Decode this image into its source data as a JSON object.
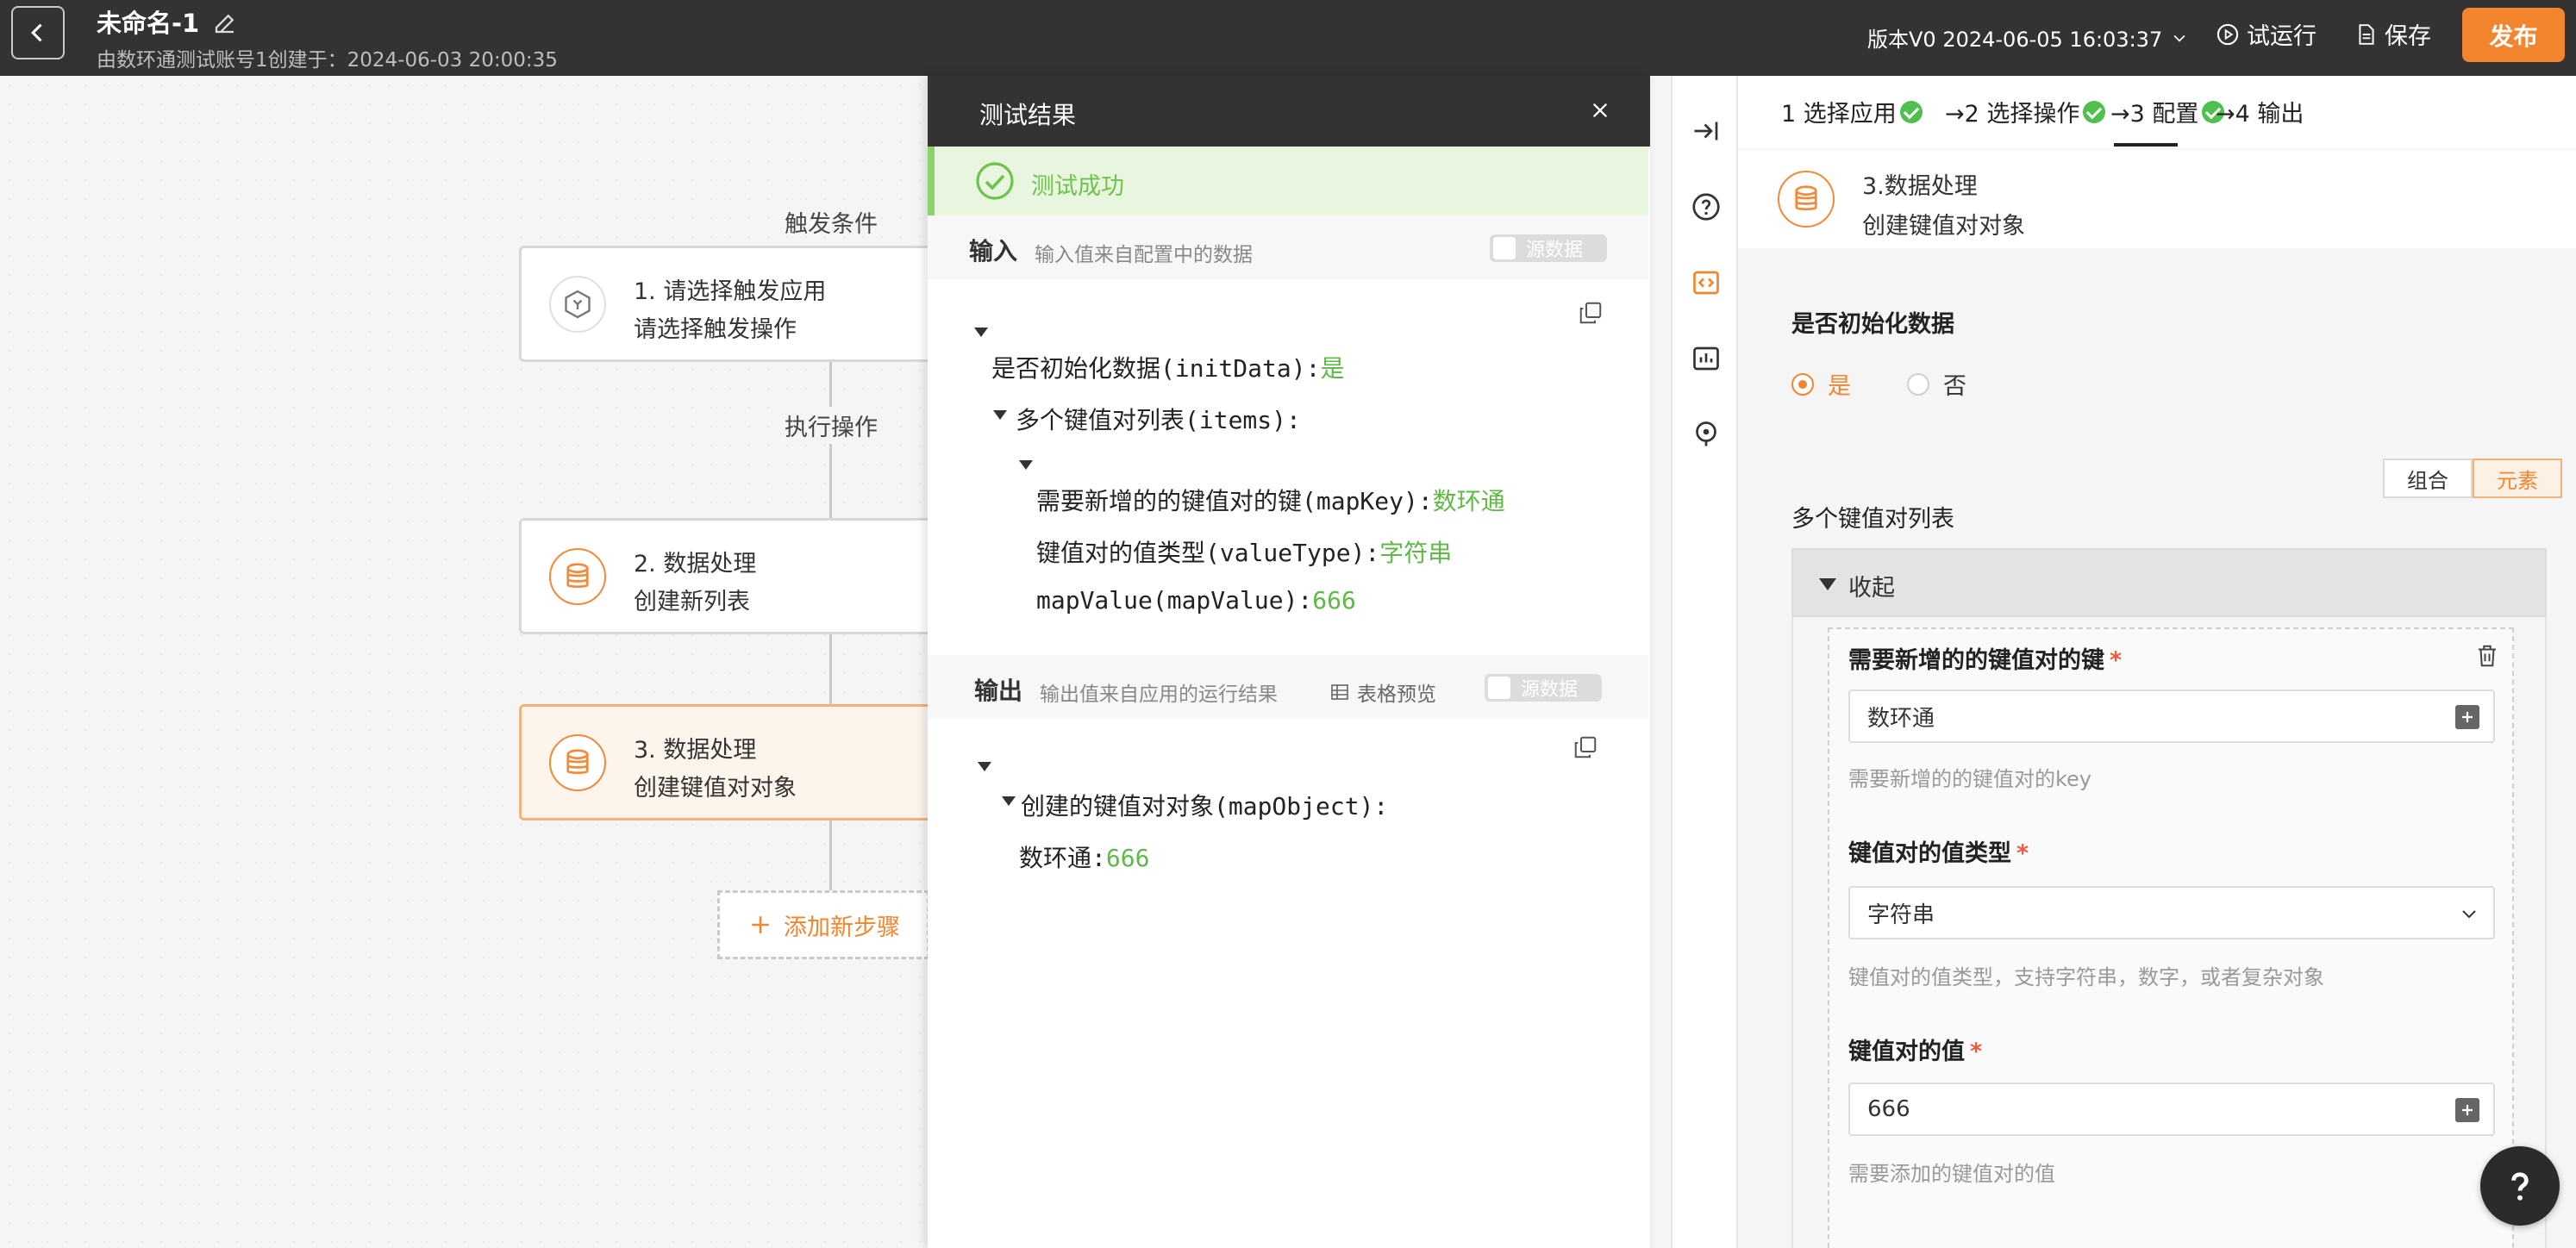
{
  "header": {
    "title": "未命名-1",
    "subtitle": "由数环通测试账号1创建于：2024-06-03 20:00:35",
    "version": "版本V0 2024-06-05 16:03:37",
    "trial_run": "试运行",
    "save": "保存",
    "publish": "发布"
  },
  "flow": {
    "trigger_label": "触发条件",
    "action_label": "执行操作",
    "nodes": [
      {
        "line1": "1. 请选择触发应用",
        "line2": "请选择触发操作"
      },
      {
        "line1": "2. 数据处理",
        "line2": "创建新列表"
      },
      {
        "line1": "3. 数据处理",
        "line2": "创建键值对对象"
      }
    ],
    "add_step": "添加新步骤"
  },
  "result": {
    "title": "测试结果",
    "success": "测试成功",
    "input": {
      "title": "输入",
      "desc": "输入值来自配置中的数据",
      "toggle": "源数据",
      "lines": [
        {
          "key": "是否初始化数据(initData):",
          "val": "是"
        },
        {
          "key": "多个键值对列表(items):",
          "val": ""
        },
        {
          "key": "需要新增的的键值对的键(mapKey):",
          "val": "数环通"
        },
        {
          "key": "键值对的值类型(valueType):",
          "val": "字符串"
        },
        {
          "key": "mapValue(mapValue):",
          "val": "666"
        }
      ]
    },
    "output": {
      "title": "输出",
      "desc": "输出值来自应用的运行结果",
      "table_preview": "表格预览",
      "toggle": "源数据",
      "lines": [
        {
          "key": "创建的键值对对象(mapObject):",
          "val": ""
        },
        {
          "key": "数环通:",
          "val": "666"
        }
      ]
    }
  },
  "config": {
    "tabs": [
      {
        "label": "1 选择应用"
      },
      {
        "label": "→2 选择操作"
      },
      {
        "label": "→3 配置"
      },
      {
        "label": "→4 输出"
      }
    ],
    "step_title": "3.数据处理",
    "step_sub": "创建键值对对象",
    "init_label": "是否初始化数据",
    "radio_yes": "是",
    "radio_no": "否",
    "seg_combine": "组合",
    "seg_element": "元素",
    "list_label": "多个键值对列表",
    "collapse": "收起",
    "key_label": "需要新增的的键值对的键",
    "key_value": "数环通",
    "key_hint": "需要新增的的键值对的key",
    "type_label": "键值对的值类型",
    "type_value": "字符串",
    "type_hint": "键值对的值类型，支持字符串，数字，或者复杂对象",
    "val_label": "键值对的值",
    "val_value": "666",
    "val_hint": "需要添加的键值对的值",
    "required_mark": "*"
  },
  "colors": {
    "accent": "#f2852e",
    "success": "#5fb946",
    "header": "#333333"
  }
}
